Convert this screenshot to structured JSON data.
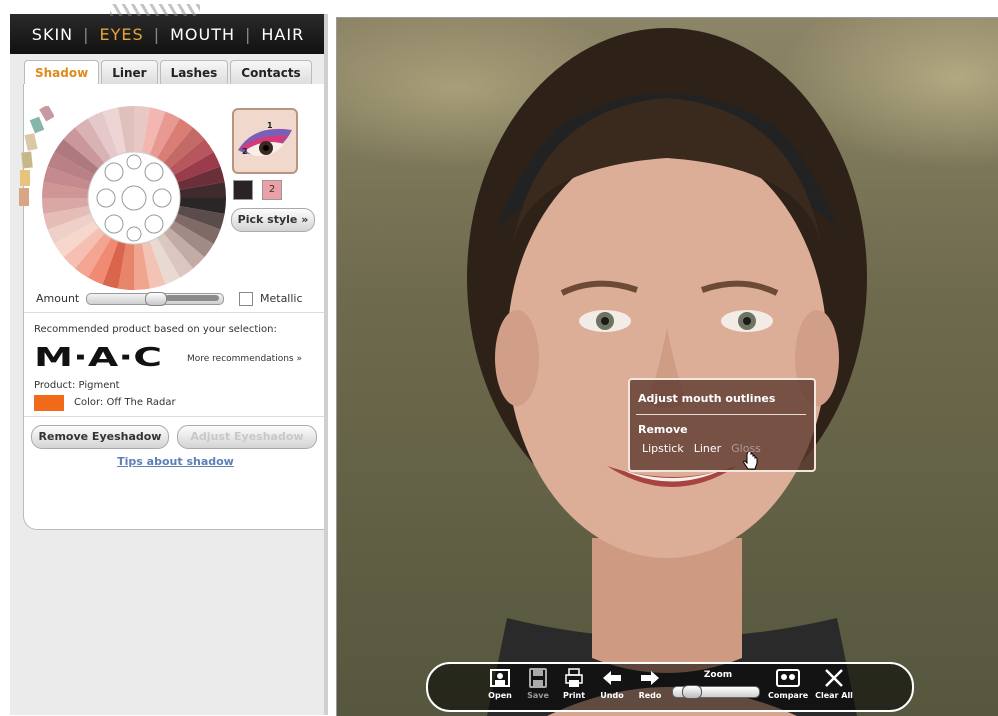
{
  "categories": [
    "SKIN",
    "EYES",
    "MOUTH",
    "HAIR"
  ],
  "active_category": "EYES",
  "tabs": [
    {
      "label": "Shadow",
      "active": true
    },
    {
      "label": "Liner",
      "active": false
    },
    {
      "label": "Lashes",
      "active": false
    },
    {
      "label": "Contacts",
      "active": false
    }
  ],
  "eye_preview": {
    "zone_1": "1",
    "zone_2": "2"
  },
  "swatches": {
    "color1": "#2a2326",
    "color2": "#eaa0a6",
    "color2_label": "2"
  },
  "pick_style_label": "Pick style »",
  "amount": {
    "label": "Amount",
    "value": 0.5
  },
  "metallic": {
    "label": "Metallic",
    "checked": false
  },
  "recommendation": {
    "intro": "Recommended product based on your selection:",
    "brand_logo": "M·A·C",
    "more_label": "More recommendations »",
    "product": "Product: Pigment",
    "color": "Color: Off The Radar",
    "color_hex": "#f06a1a"
  },
  "buttons": {
    "remove": "Remove Eyeshadow",
    "adjust": "Adjust Eyeshadow"
  },
  "tips_label": "Tips about shadow",
  "context_menu": {
    "title": "Adjust mouth outlines",
    "section": "Remove",
    "items": [
      {
        "label": "Lipstick",
        "enabled": true
      },
      {
        "label": "Liner",
        "enabled": true
      },
      {
        "label": "Gloss",
        "enabled": false
      }
    ]
  },
  "toolbar": {
    "open": "Open",
    "save": "Save",
    "print": "Print",
    "undo": "Undo",
    "redo": "Redo",
    "zoom_label": "Zoom",
    "zoom_value": 0.1,
    "compare": "Compare",
    "clear_all": "Clear All"
  },
  "colors": {
    "accent_orange": "#e7a436",
    "link_blue": "#5d7fb5"
  }
}
